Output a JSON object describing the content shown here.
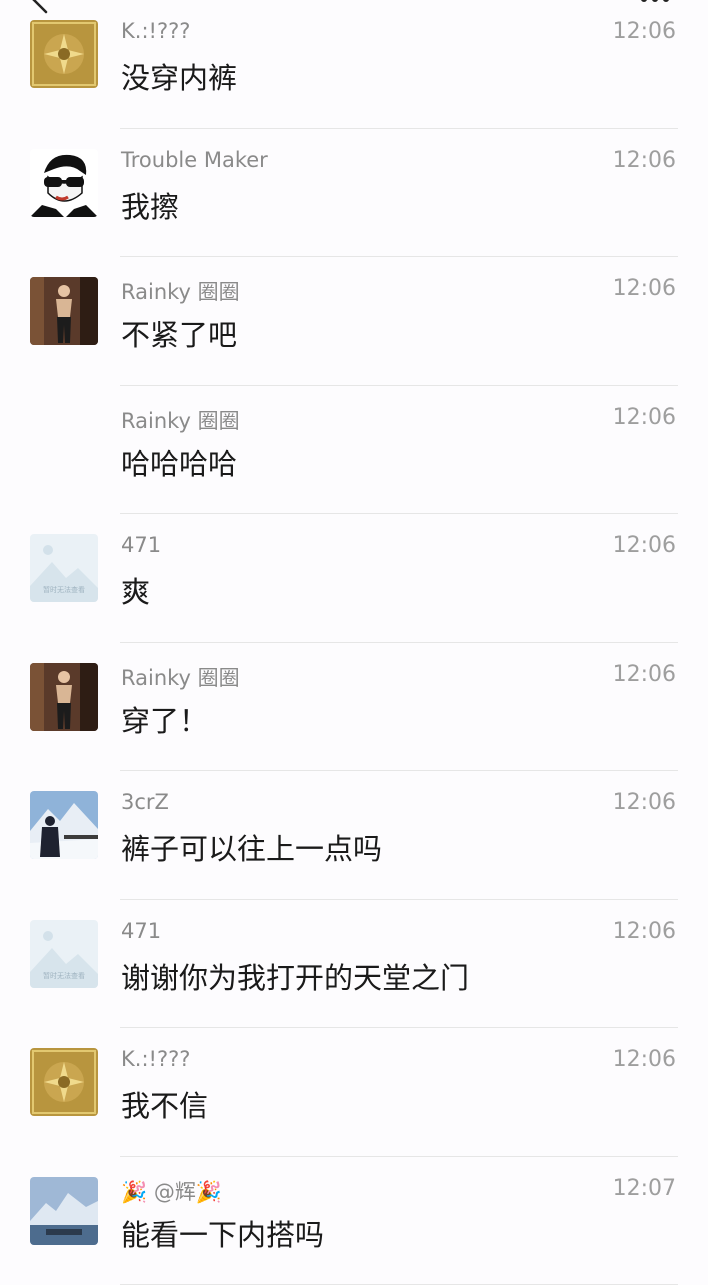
{
  "chat": {
    "messages": [
      {
        "avatar": "gold-album-art-avatar",
        "sender": "K.:!???",
        "time": "12:06",
        "text": "没穿内裤"
      },
      {
        "avatar": "sunglasses-sketch-avatar",
        "sender": "Trouble Maker",
        "time": "12:06",
        "text": "我擦"
      },
      {
        "avatar": "mirror-selfie-avatar",
        "sender": "Rainky 圈圈",
        "time": "12:06",
        "text": "不紧了吧"
      },
      {
        "avatar": "",
        "sender": "Rainky 圈圈",
        "time": "12:06",
        "text": "哈哈哈哈"
      },
      {
        "avatar": "image-placeholder-avatar",
        "sender": "471",
        "time": "12:06",
        "text": "爽"
      },
      {
        "avatar": "mirror-selfie-avatar",
        "sender": "Rainky 圈圈",
        "time": "12:06",
        "text": "穿了！"
      },
      {
        "avatar": "snow-mountain-avatar",
        "sender": "3crZ",
        "time": "12:06",
        "text": "裤子可以往上一点吗"
      },
      {
        "avatar": "image-placeholder-avatar",
        "sender": "471",
        "time": "12:06",
        "text": "谢谢你为我打开的天堂之门"
      },
      {
        "avatar": "gold-album-art-avatar",
        "sender": "K.:!???",
        "time": "12:06",
        "text": "我不信"
      },
      {
        "avatar": "mountain-lake-avatar",
        "sender": "🎉 @辉🎉",
        "time": "12:07",
        "text": "能看一下内搭吗"
      }
    ],
    "placeholder_caption": "暂时无法查看"
  }
}
